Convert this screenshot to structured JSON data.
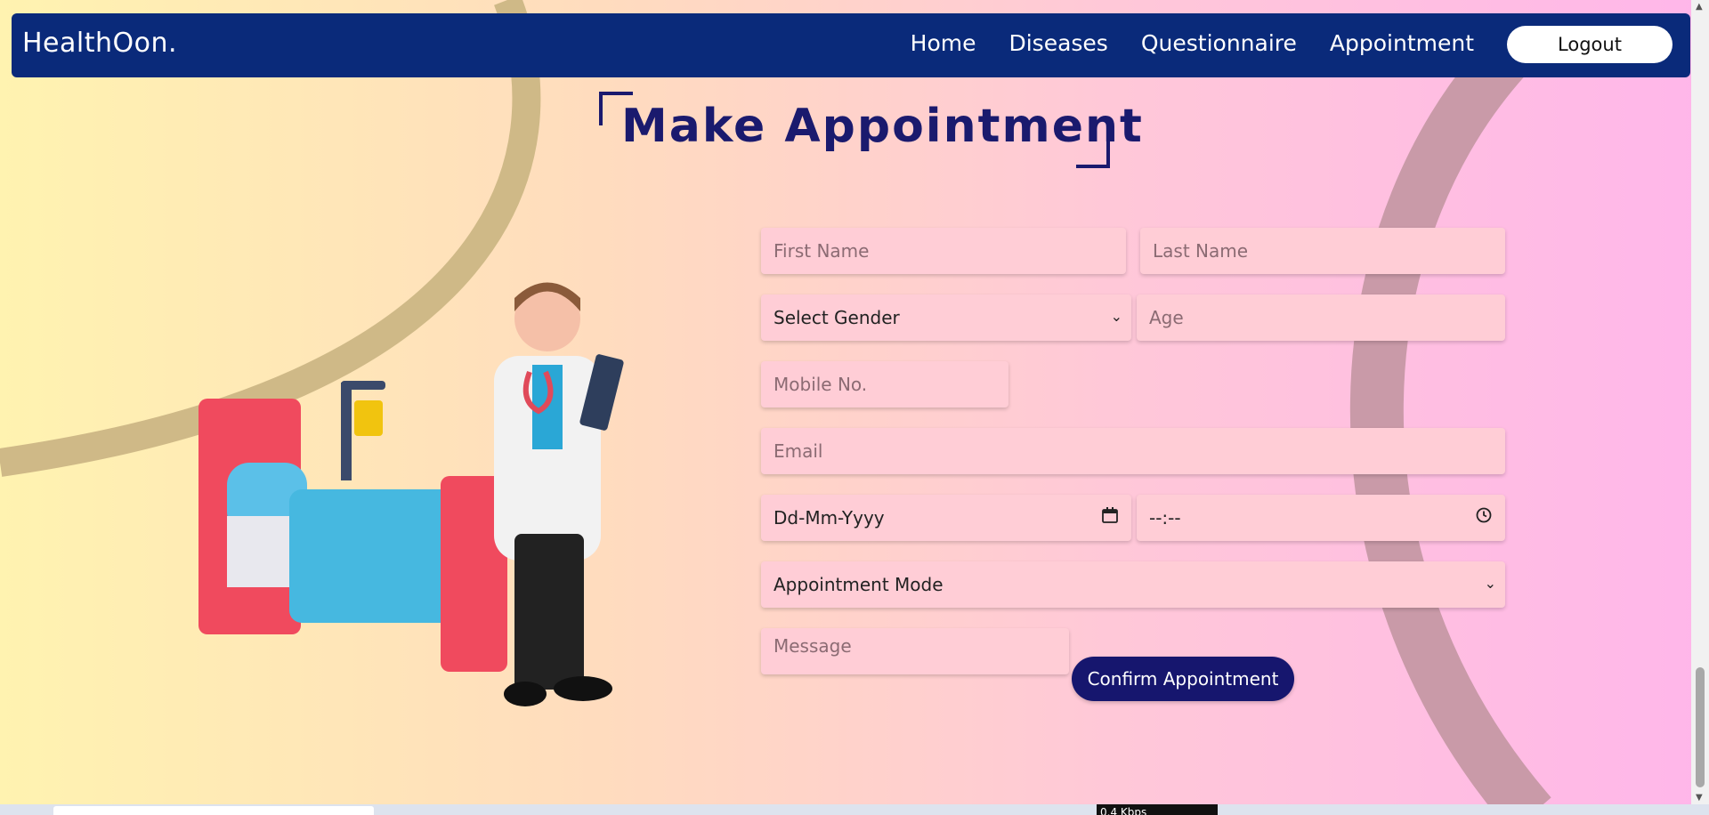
{
  "navbar": {
    "brand": "HealthOon.",
    "links": [
      "Home",
      "Diseases",
      "Questionnaire",
      "Appointment"
    ],
    "logout_label": "Logout"
  },
  "page": {
    "title": "Make Appointment"
  },
  "form": {
    "first_name_placeholder": "First Name",
    "last_name_placeholder": "Last Name",
    "gender_selected": "Select Gender",
    "age_placeholder": "Age",
    "mobile_placeholder": "Mobile No.",
    "email_placeholder": "Email",
    "date_placeholder": "Dd-Mm-Yyyy",
    "time_placeholder": "--:--",
    "mode_selected": "Appointment Mode",
    "message_placeholder": "Message",
    "confirm_label": "Confirm Appointment"
  },
  "taskbar": {
    "network_speed": "0.4 Kbps"
  },
  "colors": {
    "navbar": "#0a2a7a",
    "title": "#1a1a6e",
    "field": "#ffcdd6",
    "button": "#16166e"
  },
  "icons": [
    "calendar-icon",
    "clock-icon",
    "chevron-down-icon",
    "doctor-illustration",
    "hospital-bed-illustration"
  ]
}
